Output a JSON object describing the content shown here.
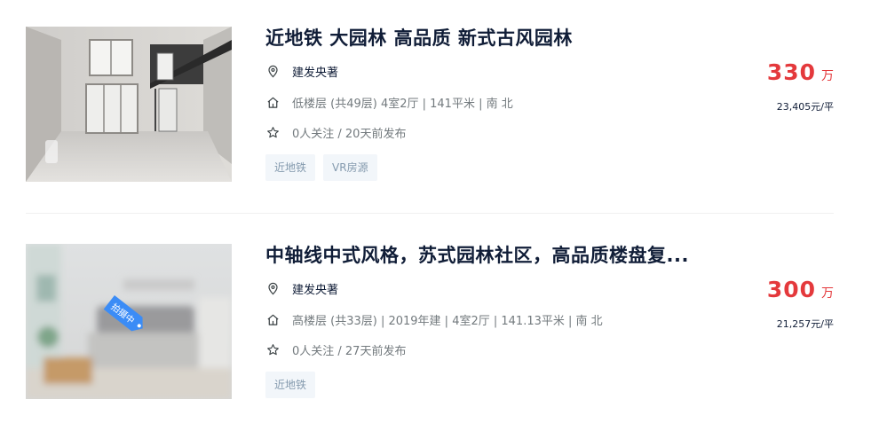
{
  "listings": [
    {
      "title": "近地铁 大园林 高品质 新式古风园林",
      "community": "建发央著",
      "house_info": "低楼层 (共49层) 4室2厅 | 141平米 | 南 北",
      "follow_info": "0人关注 / 20天前发布",
      "tags": [
        "近地铁",
        "VR房源"
      ],
      "total_price": "330",
      "total_price_unit": "万",
      "unit_price": "23,405元/平",
      "image": "loft-interior-photo"
    },
    {
      "title": "中轴线中式风格，苏式园林社区，高品质楼盘复...",
      "community": "建发央著",
      "house_info": "高楼层 (共33层) | 2019年建 | 4室2厅 | 141.13平米 | 南 北",
      "follow_info": "0人关注 / 27天前发布",
      "tags": [
        "近地铁"
      ],
      "total_price": "300",
      "total_price_unit": "万",
      "unit_price": "21,257元/平",
      "image": "blurred-bedroom-photo",
      "badge": "拍摄中"
    }
  ],
  "colors": {
    "price": "#e4393c",
    "title": "#101d37",
    "tag_bg": "#f2f6fa",
    "tag_text": "#849aae",
    "badge": "#3b8cf6"
  }
}
